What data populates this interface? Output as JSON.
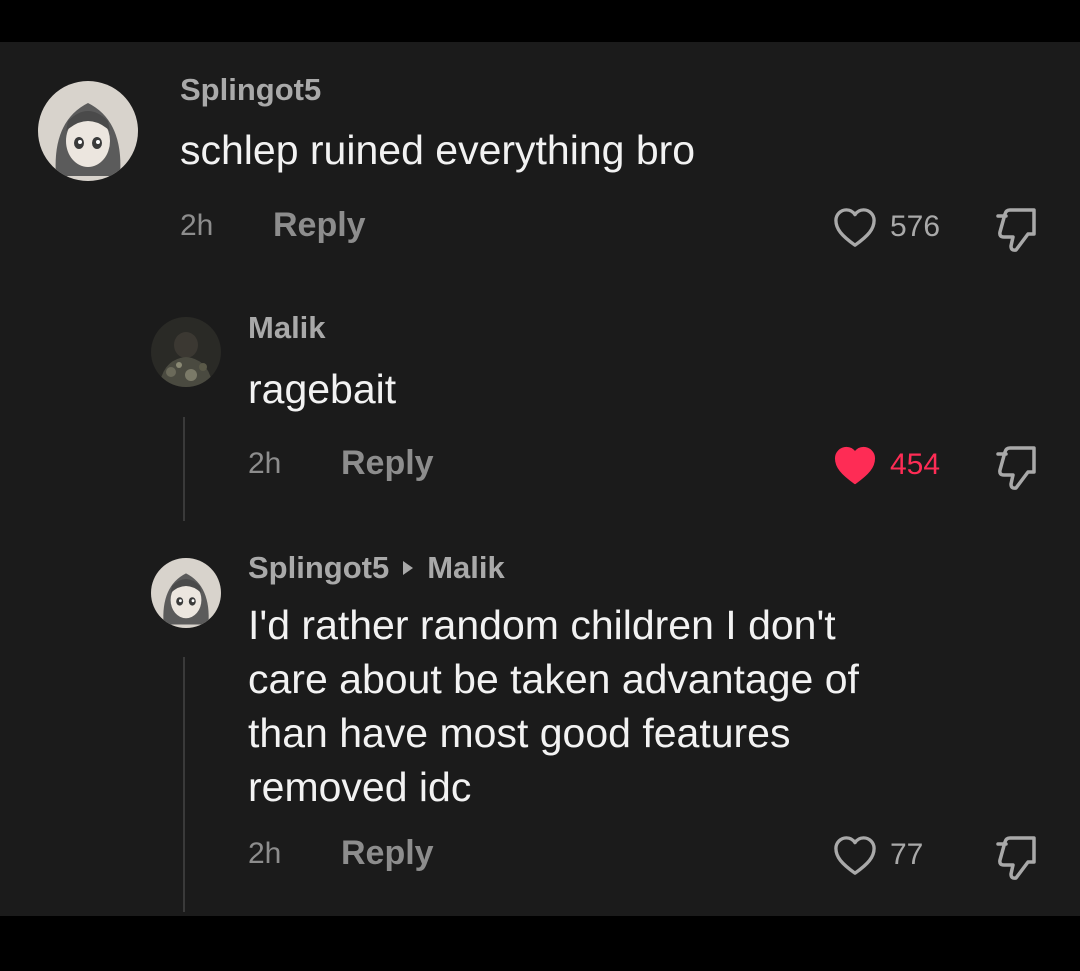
{
  "comments": [
    {
      "username": "Splingot5",
      "text": "schlep ruined everything bro",
      "time": "2h",
      "reply_label": "Reply",
      "likes": "576",
      "liked": false,
      "avatar": "anime-girl-avatar"
    },
    {
      "username": "Malik",
      "text": "ragebait",
      "time": "2h",
      "reply_label": "Reply",
      "likes": "454",
      "liked": true,
      "avatar": "camo-photo-avatar"
    },
    {
      "username": "Splingot5",
      "reply_to": "Malik",
      "text_lines": [
        "I'd rather random children I don't",
        "care about be taken advantage of",
        "than have most good features",
        "removed idc"
      ],
      "time": "2h",
      "reply_label": "Reply",
      "likes": "77",
      "liked": false,
      "avatar": "anime-girl-avatar"
    }
  ],
  "colors": {
    "background": "#1b1b1b",
    "outer": "#000000",
    "liked_heart": "#fe2c55",
    "muted_text": "#8d8d8d",
    "body_text": "#f2f2f2"
  },
  "icons": {
    "like": "heart-icon",
    "dislike": "thumbs-down-icon"
  }
}
